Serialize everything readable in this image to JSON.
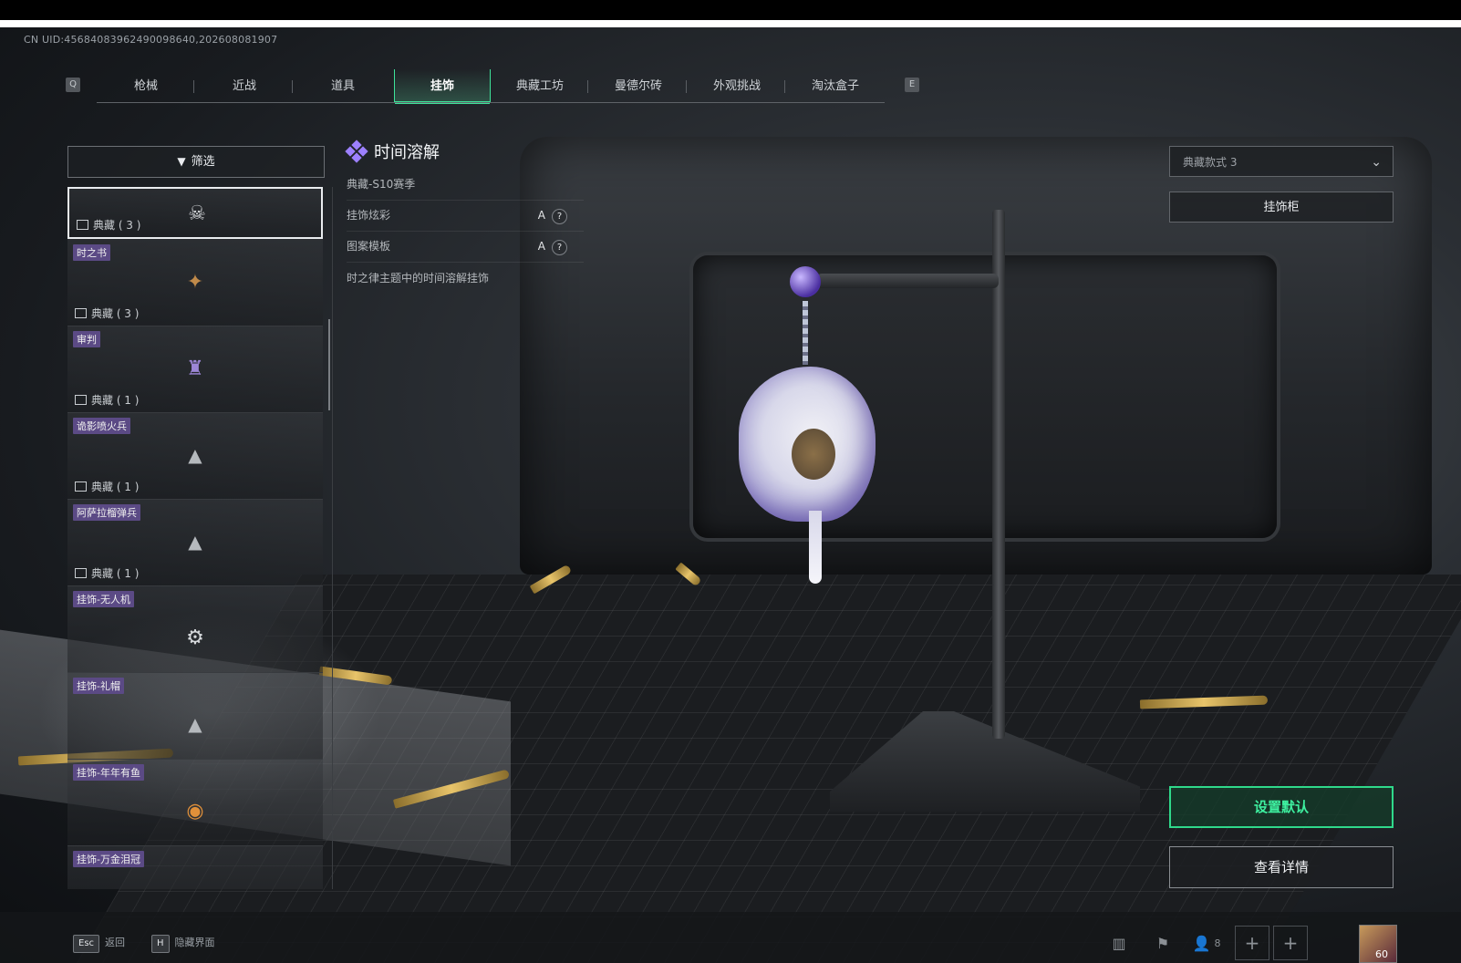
{
  "uid_text": "CN UID:456840839624900986​40,20260808​1907",
  "tabs": {
    "prev_key": "Q",
    "next_key": "E",
    "items": [
      "枪械",
      "近战",
      "道具",
      "挂饰",
      "典藏工坊",
      "曼德尔砖",
      "外观挑战",
      "淘汰盒子"
    ],
    "active_index": 3
  },
  "filter": {
    "label": "筛选"
  },
  "list": {
    "items": [
      {
        "tag": "",
        "footer": "典藏 ( 3 )",
        "icon": "skull-charm-icon",
        "selected": true
      },
      {
        "tag": "时之书",
        "footer": "典藏 ( 3 )",
        "icon": "book-charm-icon"
      },
      {
        "tag": "审判",
        "footer": "典藏 ( 1 )",
        "icon": "pendant-charm-icon"
      },
      {
        "tag": "诡影喷火兵",
        "footer": "典藏 ( 1 )",
        "icon": "placeholder-triangle-icon"
      },
      {
        "tag": "阿萨拉榴弹兵",
        "footer": "典藏 ( 1 )",
        "icon": "placeholder-triangle-icon"
      },
      {
        "tag": "挂饰-无人机",
        "footer": "",
        "icon": "drone-charm-icon"
      },
      {
        "tag": "挂饰-礼帽",
        "footer": "",
        "icon": "placeholder-triangle-icon"
      },
      {
        "tag": "挂饰-年年有鱼",
        "footer": "",
        "icon": "fish-charm-icon"
      },
      {
        "tag": "挂饰-万金泪冠",
        "footer": "",
        "icon": "crown-charm-icon"
      }
    ]
  },
  "detail": {
    "title": "时间溶解",
    "season": "典藏-S10赛季",
    "rows": [
      {
        "label": "挂饰炫彩",
        "grade": "A",
        "help": "?"
      },
      {
        "label": "图案模板",
        "grade": "A",
        "help": "?"
      }
    ],
    "description": "时之律主题中的时间溶解挂饰"
  },
  "right_panel": {
    "style_select_value": "典藏款式 3",
    "cabinet_label": "挂饰柜",
    "set_default_label": "设置默认",
    "view_detail_label": "查看详情"
  },
  "bottom": {
    "hints": [
      {
        "key": "Esc",
        "label": "返回"
      },
      {
        "key": "H",
        "label": "隐藏界面"
      }
    ],
    "friends_count": "8",
    "level": "60"
  },
  "colors": {
    "accent": "#3ee39a",
    "tag_bg": "#5b4a85",
    "rarity": "#9d80ff"
  }
}
